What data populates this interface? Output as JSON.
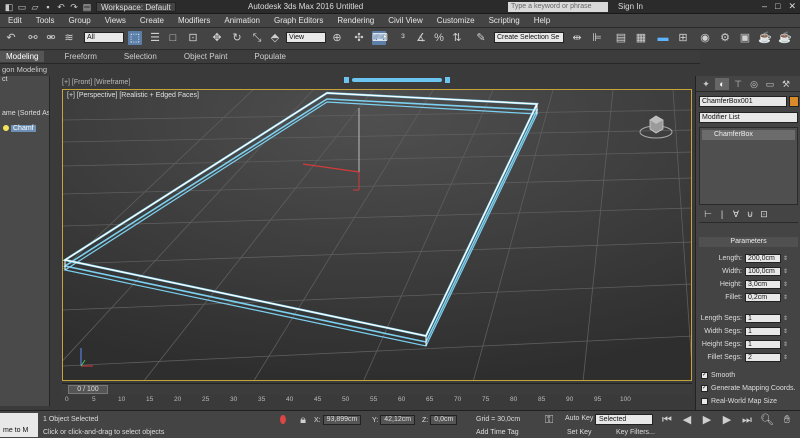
{
  "title_bar": {
    "workspace": "Workspace: Default",
    "app_title": "Autodesk 3ds Max 2016     Untitled",
    "search_placeholder": "Type a keyword or phrase",
    "sign_in": "Sign In"
  },
  "menu": [
    "Edit",
    "Tools",
    "Group",
    "Views",
    "Create",
    "Modifiers",
    "Animation",
    "Graph Editors",
    "Rendering",
    "Civil View",
    "Customize",
    "Scripting",
    "Help"
  ],
  "toolbar": {
    "filter": "All",
    "ref_coord": "View",
    "named_sel": "Create Selection Se"
  },
  "ribbon": {
    "tabs": [
      "Modeling",
      "Freeform",
      "Selection",
      "Object Paint",
      "Populate"
    ],
    "sub": "gon Modeling"
  },
  "scene_explorer": {
    "header": "ct",
    "sort_label": "ame (Sorted As",
    "item": "Chamf"
  },
  "viewport": {
    "top_label": "[+] [Front] [Wireframe]",
    "label": "[+] [Perspective] [Realistic + Edged Faces]"
  },
  "timeline": {
    "frame": "0 / 100"
  },
  "ruler": [
    "0",
    "5",
    "10",
    "15",
    "20",
    "25",
    "30",
    "35",
    "40",
    "45",
    "50",
    "55",
    "60",
    "65",
    "70",
    "75",
    "80",
    "85",
    "90",
    "95",
    "100"
  ],
  "status": {
    "maxscript_1": "",
    "maxscript_2": "me to M",
    "selected": "1 Object Selected",
    "prompt": "Click or click-and-drag to select objects",
    "x_label": "X:",
    "x": "93,899cm",
    "y_label": "Y:",
    "y": "42,12cm",
    "z_label": "Z:",
    "z": "0,0cm",
    "grid": "Grid = 30,0cm",
    "add_time_tag": "Add Time Tag",
    "auto_key": "Auto Key",
    "set_key": "Set Key",
    "selected_dropdown": "Selected",
    "key_filters": "Key Filters..."
  },
  "command_panel": {
    "object_name": "ChamferBox001",
    "object_color": "#d98a2a",
    "modifier_list": "Modifier List",
    "stack_item": "ChamferBox",
    "params_header": "Parameters",
    "params": [
      {
        "label": "Length:",
        "value": "200,0cm"
      },
      {
        "label": "Width:",
        "value": "100,0cm"
      },
      {
        "label": "Height:",
        "value": "3,0cm"
      },
      {
        "label": "Fillet:",
        "value": "0,2cm"
      },
      {
        "label": "Length Segs:",
        "value": "1"
      },
      {
        "label": "Width Segs:",
        "value": "1"
      },
      {
        "label": "Height Segs:",
        "value": "1"
      },
      {
        "label": "Fillet Segs:",
        "value": "2"
      }
    ],
    "smooth": "Smooth",
    "gen_mapping": "Generate Mapping Coords.",
    "real_world": "Real-World Map Size"
  }
}
